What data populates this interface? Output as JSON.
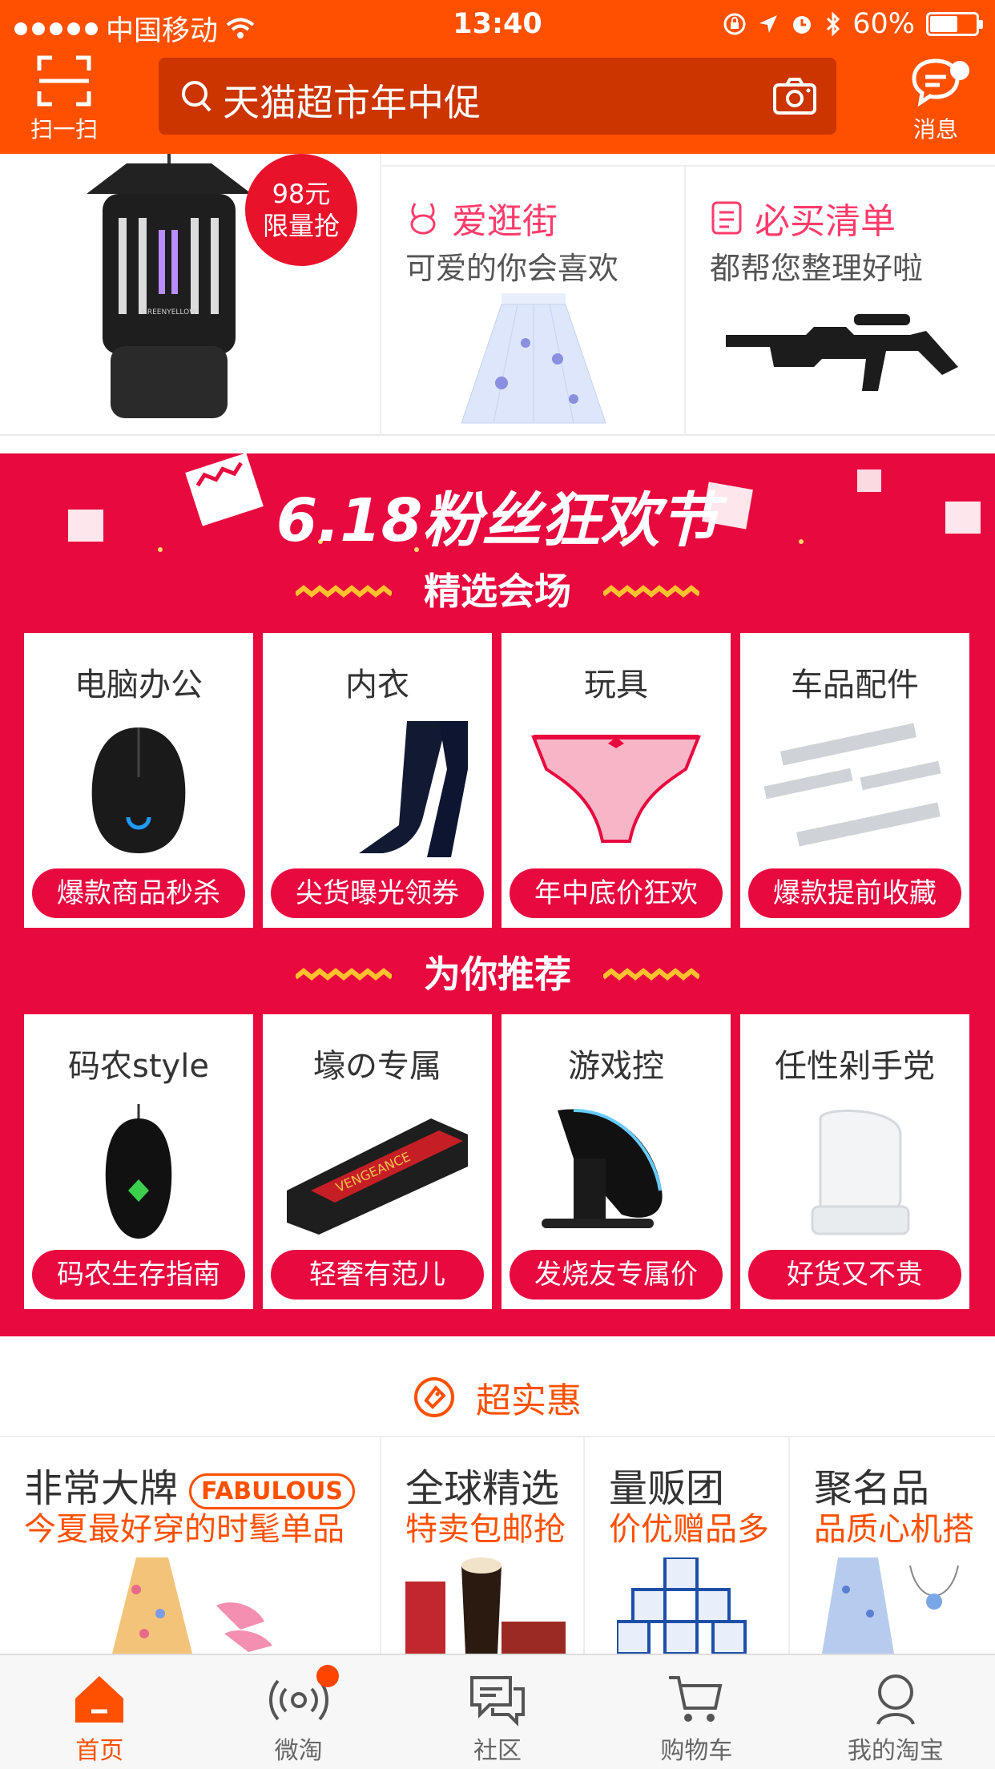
{
  "status_bar": {
    "carrier": "中国移动",
    "time": "13:40",
    "battery": "60%",
    "battery_level": 0.6
  },
  "header": {
    "scan_label": "扫一扫",
    "search_text": "天猫超市年中促",
    "message_label": "消息"
  },
  "top_promos": {
    "product_badge": "98元限量抢",
    "badge_line1": "98元",
    "badge_line2": "限量抢",
    "items": [
      {
        "title": "爱逛街",
        "subtitle": "可爱的你会喜欢",
        "icon": "bunny-icon"
      },
      {
        "title": "必买清单",
        "subtitle": "都帮您整理好啦",
        "icon": "list-icon"
      }
    ]
  },
  "festival": {
    "title": "6.18粉丝狂欢节",
    "section1_title": "精选会场",
    "section1_cards": [
      {
        "name": "电脑办公",
        "tag": "爆款商品秒杀",
        "art": "mouse"
      },
      {
        "name": "内衣",
        "tag": "尖货曝光领券",
        "art": "stockings"
      },
      {
        "name": "玩具",
        "tag": "年中底价狂欢",
        "art": "underwear"
      },
      {
        "name": "车品配件",
        "tag": "爆款提前收藏",
        "art": "sills"
      }
    ],
    "section2_title": "为你推荐",
    "section2_cards": [
      {
        "name": "码农style",
        "tag": "码农生存指南",
        "art": "razer-mouse"
      },
      {
        "name": "壕の专属",
        "tag": "轻奢有范儿",
        "art": "ram"
      },
      {
        "name": "游戏控",
        "tag": "发烧友专属价",
        "art": "gaming-mouse"
      },
      {
        "name": "任性剁手党",
        "tag": "好货又不贵",
        "art": "toilet-seat"
      }
    ]
  },
  "deals": {
    "header": "超实惠",
    "items": [
      {
        "title": "非常大牌",
        "badge": "FABULOUS",
        "subtitle": "今夏最好穿的时髦单品"
      },
      {
        "title": "全球精选",
        "subtitle": "特卖包邮抢"
      },
      {
        "title": "量贩团",
        "subtitle": "价优赠品多"
      },
      {
        "title": "聚名品",
        "subtitle": "品质心机搭"
      }
    ]
  },
  "tabbar": {
    "tabs": [
      {
        "label": "首页",
        "icon": "home-icon",
        "active": true
      },
      {
        "label": "微淘",
        "icon": "broadcast-icon",
        "active": false,
        "badge": true
      },
      {
        "label": "社区",
        "icon": "chat-bubbles-icon",
        "active": false
      },
      {
        "label": "购物车",
        "icon": "cart-icon",
        "active": false
      },
      {
        "label": "我的淘宝",
        "icon": "user-icon",
        "active": false
      }
    ]
  },
  "colors": {
    "brand_orange": "#ff5000",
    "festival_red": "#e8093f",
    "pink_title": "#ff3b6b"
  }
}
